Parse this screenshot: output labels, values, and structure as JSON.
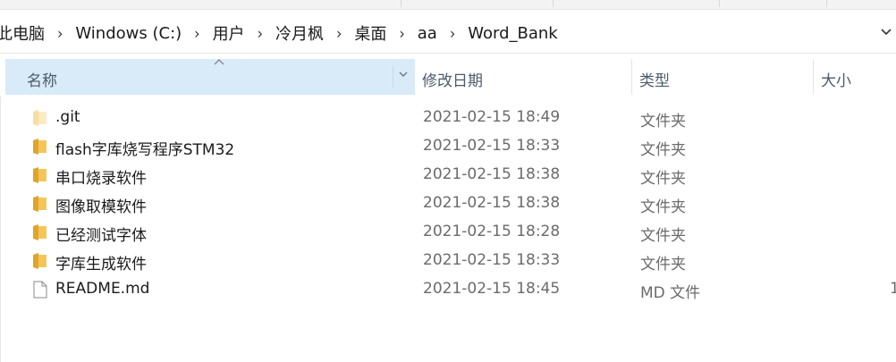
{
  "breadcrumb": {
    "items": [
      "此电脑",
      "Windows (C:)",
      "用户",
      "冷月枫",
      "桌面",
      "aa",
      "Word_Bank"
    ],
    "separator": "›",
    "dropdown_icon": "chevron-down-icon"
  },
  "columns": {
    "name": "名称",
    "date": "修改日期",
    "type": "类型",
    "size": "大小"
  },
  "files": [
    {
      "name": ".git",
      "date": "2021-02-15 18:49",
      "type": "文件夹",
      "size": "",
      "icon": "hidden-folder-icon"
    },
    {
      "name": "flash字库烧写程序STM32",
      "date": "2021-02-15 18:33",
      "type": "文件夹",
      "size": "",
      "icon": "folder-icon"
    },
    {
      "name": "串口烧录软件",
      "date": "2021-02-15 18:38",
      "type": "文件夹",
      "size": "",
      "icon": "folder-icon"
    },
    {
      "name": "图像取模软件",
      "date": "2021-02-15 18:38",
      "type": "文件夹",
      "size": "",
      "icon": "folder-icon"
    },
    {
      "name": "已经测试字体",
      "date": "2021-02-15 18:28",
      "type": "文件夹",
      "size": "",
      "icon": "folder-icon"
    },
    {
      "name": "字库生成软件",
      "date": "2021-02-15 18:33",
      "type": "文件夹",
      "size": "",
      "icon": "folder-icon"
    },
    {
      "name": "README.md",
      "date": "2021-02-15 18:45",
      "type": "MD 文件",
      "size": "1",
      "icon": "document-icon"
    }
  ],
  "colors": {
    "header_selected": "#d9ebf9",
    "folder": "#f4c65a",
    "folder_dark": "#e0a52a"
  }
}
